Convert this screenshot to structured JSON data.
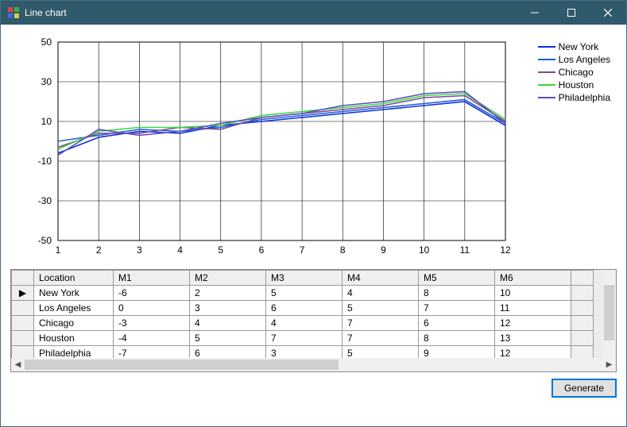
{
  "window": {
    "title": "Line chart"
  },
  "chart_data": {
    "type": "line",
    "x": [
      1,
      2,
      3,
      4,
      5,
      6,
      7,
      8,
      9,
      10,
      11,
      12
    ],
    "series": [
      {
        "name": "New York",
        "color": "#0a2ee0",
        "values": [
          -6,
          2,
          5,
          4,
          8,
          10,
          12,
          14,
          16,
          18,
          20,
          8
        ]
      },
      {
        "name": "Los Angeles",
        "color": "#1e5ed0",
        "values": [
          0,
          3,
          6,
          5,
          7,
          11,
          13,
          15,
          17,
          19,
          21,
          9
        ]
      },
      {
        "name": "Chicago",
        "color": "#7a4a9c",
        "values": [
          -3,
          4,
          4,
          7,
          6,
          12,
          14,
          16,
          18,
          22,
          23,
          10
        ]
      },
      {
        "name": "Houston",
        "color": "#3fd63f",
        "values": [
          -4,
          5,
          7,
          7,
          8,
          13,
          15,
          17,
          19,
          23,
          24,
          11
        ]
      },
      {
        "name": "Philadelphia",
        "color": "#5a4dbd",
        "values": [
          -7,
          6,
          3,
          5,
          9,
          12,
          14,
          18,
          20,
          24,
          25,
          9
        ]
      }
    ],
    "xlabel": "",
    "ylabel": "",
    "xlim": [
      1,
      12
    ],
    "ylim": [
      -50,
      50
    ],
    "xticks": [
      1,
      2,
      3,
      4,
      5,
      6,
      7,
      8,
      9,
      10,
      11,
      12
    ],
    "yticks": [
      -50,
      -30,
      -10,
      10,
      30,
      50
    ],
    "grid": true
  },
  "table": {
    "columns": [
      "Location",
      "M1",
      "M2",
      "M3",
      "M4",
      "M5",
      "M6"
    ],
    "rows": [
      [
        "New York",
        "-6",
        "2",
        "5",
        "4",
        "8",
        "10"
      ],
      [
        "Los Angeles",
        "0",
        "3",
        "6",
        "5",
        "7",
        "11"
      ],
      [
        "Chicago",
        "-3",
        "4",
        "4",
        "7",
        "6",
        "12"
      ],
      [
        "Houston",
        "-4",
        "5",
        "7",
        "7",
        "8",
        "13"
      ],
      [
        "Philadelphia",
        "-7",
        "6",
        "3",
        "5",
        "9",
        "12"
      ]
    ]
  },
  "buttons": {
    "generate": "Generate"
  }
}
